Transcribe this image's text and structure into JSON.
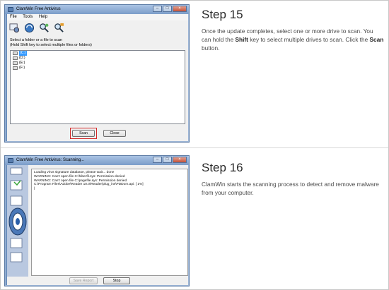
{
  "step15": {
    "title": "Step 15",
    "text_a": "Once the update completes, select one or more drive to scan. You can hold the ",
    "text_b": "Shift",
    "text_c": " key to select multiple drives to scan. Click the ",
    "text_d": "Scan",
    "text_e": " button."
  },
  "step16": {
    "title": "Step 16",
    "text": "ClamWin starts the scanning process to detect and remove malware from your computer."
  },
  "window1": {
    "title": "ClamWin Free Antivirus",
    "menu": [
      "File",
      "Tools",
      "Help"
    ],
    "toolbar_icons": [
      "preferences-icon",
      "update-icon",
      "scan-files-icon",
      "scan-memory-icon"
    ],
    "instruction_1": "Select a folder or a file to scan",
    "instruction_2": "(Hold Shift key to select multiple files or folders)",
    "drives": [
      "(C:)",
      "(D:)",
      "(E:)",
      "(F:)"
    ],
    "scan_label": "Scan",
    "close_label": "Close"
  },
  "window2": {
    "title": "ClamWin Free Antivirus: Scanning...",
    "log": [
      "Loading virus signature database, please wait... done",
      "WARNING: Can't open file C:\\hiberfil.sys: Permission denied",
      "WARNING: Can't open file C:\\pagefile.sys: Permission denied",
      "C:\\Program Files\\Adobe\\Reader 10.0\\Reader\\plug_ins\\PDDom.api: [  1%]",
      "|"
    ],
    "save_report_label": "Save Report",
    "stop_label": "Stop"
  },
  "colors": {
    "highlight": "#d22a2a",
    "selection": "#3399ff",
    "titlebar": "#7b9dc9"
  }
}
